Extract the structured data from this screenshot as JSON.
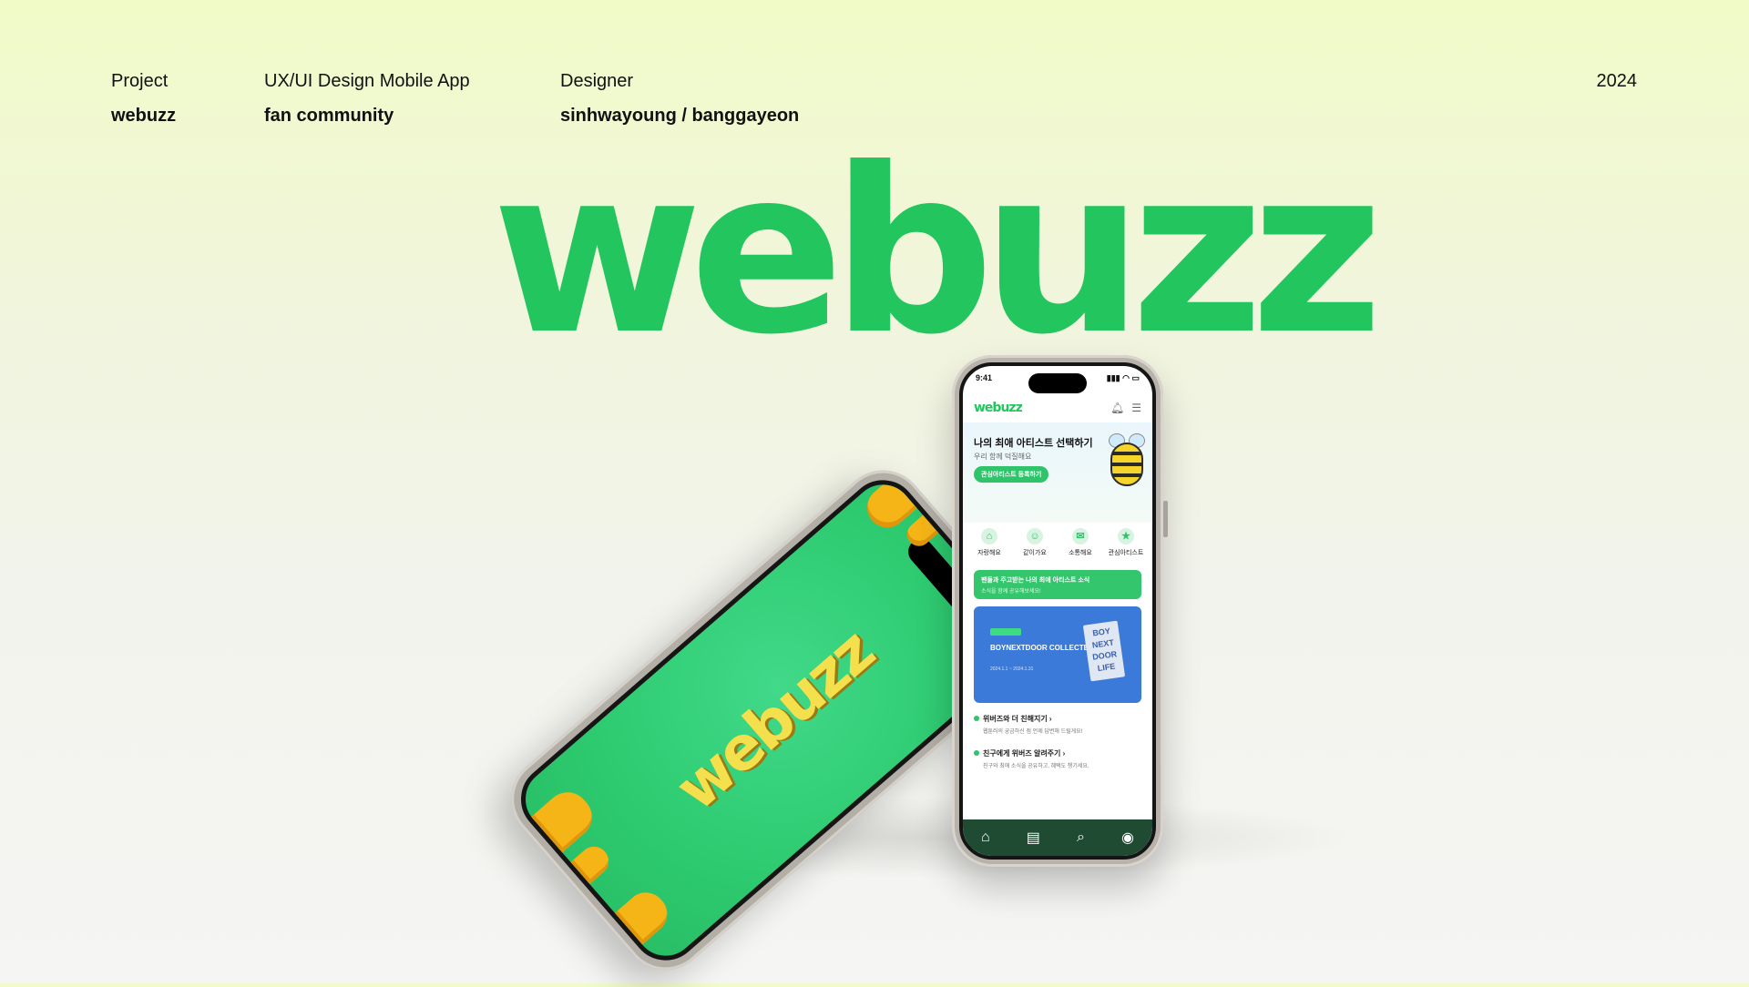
{
  "header": {
    "project": {
      "label": "Project",
      "value": "webuzz"
    },
    "app": {
      "label": "UX/UI Design Mobile App",
      "value": "fan community"
    },
    "designer": {
      "label": "Designer",
      "value": "sinhwayoung / banggayeon"
    },
    "year": "2024"
  },
  "brand": {
    "logo_text": "webuzz",
    "color": "#22c55e"
  },
  "splash_phone": {
    "logo_text": "webuzz",
    "background_color": "#2ecb70",
    "logo_color": "#f4e04c"
  },
  "app_phone": {
    "status": {
      "time": "9:41",
      "signal": "▮▮▮ ◠ ▭"
    },
    "logo": "webuzz",
    "head_icons": [
      "bell-icon",
      "menu-icon"
    ],
    "hero": {
      "title": "나의 최애 아티스트 선택하기",
      "subtitle": "우리 함께 덕질해요",
      "button": "관심아티스트 등록하기"
    },
    "menu": [
      {
        "label": "자랑해요",
        "icon": "⌂"
      },
      {
        "label": "같이가요",
        "icon": "☺"
      },
      {
        "label": "소통해요",
        "icon": "✉"
      },
      {
        "label": "관심아티스트",
        "icon": "★"
      }
    ],
    "notice": {
      "line1": "팬들과 주고받는 나의 최애 아티스트 소식",
      "line2": "소식을 함께 공유해보세요!"
    },
    "banner": {
      "title": "BOYNEXTDOOR COLLECTED BOOK",
      "detail": "2024.1.1 ~ 2024.1.31",
      "book_text": "BOY NEXT DOOR LIFE"
    },
    "links": [
      {
        "title": "위버즈와 더 친해지기",
        "sub": "웹툰러의 궁금하신 점 언제 답변해 드릴게요!"
      },
      {
        "title": "친구에게 위버즈 알려주기",
        "sub": "친구와 최애 소식을 공유하고, 혜택도 챙기세요."
      }
    ],
    "tabs": [
      "home-icon",
      "board-icon",
      "search-icon",
      "profile-icon"
    ],
    "accent": "#2fc46a",
    "banner_color": "#3b7ad8",
    "tabbar_color": "#1f4b33"
  }
}
